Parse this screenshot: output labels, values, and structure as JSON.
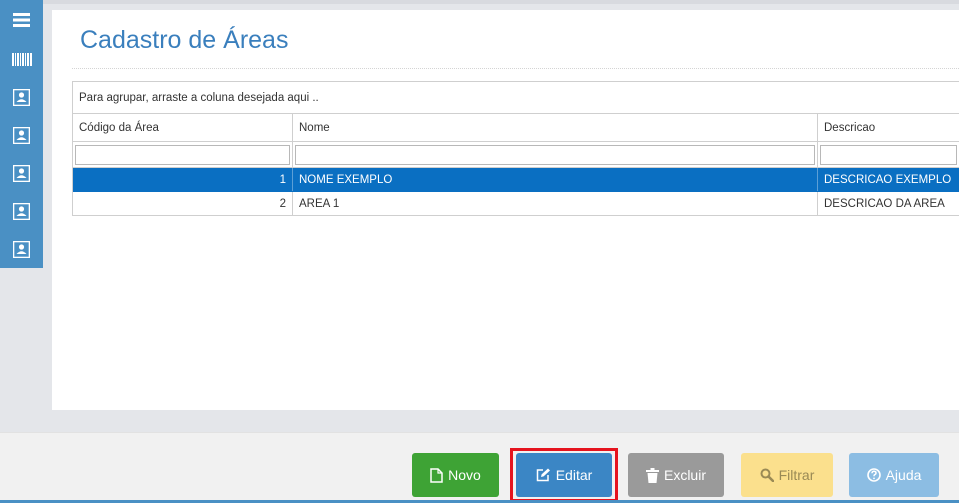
{
  "sidebar": {
    "items": [
      {
        "icon": "menu-icon"
      },
      {
        "icon": "barcode-icon"
      },
      {
        "icon": "contact-card-icon"
      },
      {
        "icon": "contact-card-icon"
      },
      {
        "icon": "contact-card-icon"
      },
      {
        "icon": "contact-card-icon"
      },
      {
        "icon": "contact-card-icon"
      }
    ]
  },
  "page": {
    "title": "Cadastro de Áreas"
  },
  "grid": {
    "group_hint": "Para agrupar, arraste a coluna desejada aqui ..",
    "columns": [
      "Código da Área",
      "Nome",
      "Descricao"
    ],
    "rows": [
      {
        "codigo": "1",
        "nome": "NOME EXEMPLO",
        "descricao": "DESCRICAO EXEMPLO",
        "selected": true
      },
      {
        "codigo": "2",
        "nome": "AREA 1",
        "descricao": "DESCRICAO DA AREA",
        "selected": false
      }
    ]
  },
  "toolbar": {
    "novo_label": "Novo",
    "editar_label": "Editar",
    "excluir_label": "Excluir",
    "filtrar_label": "Filtrar",
    "ajuda_label": "Ajuda"
  },
  "colors": {
    "sidebar": "#4a90c4",
    "title": "#3a7fbd",
    "selected_row": "#0a6fc2",
    "novo": "#3ea335",
    "editar": "#3b86c5",
    "excluir": "#9a9a9a",
    "filtrar": "#fbe08d",
    "ajuda": "#8cbde3",
    "highlight": "#e5141e"
  }
}
